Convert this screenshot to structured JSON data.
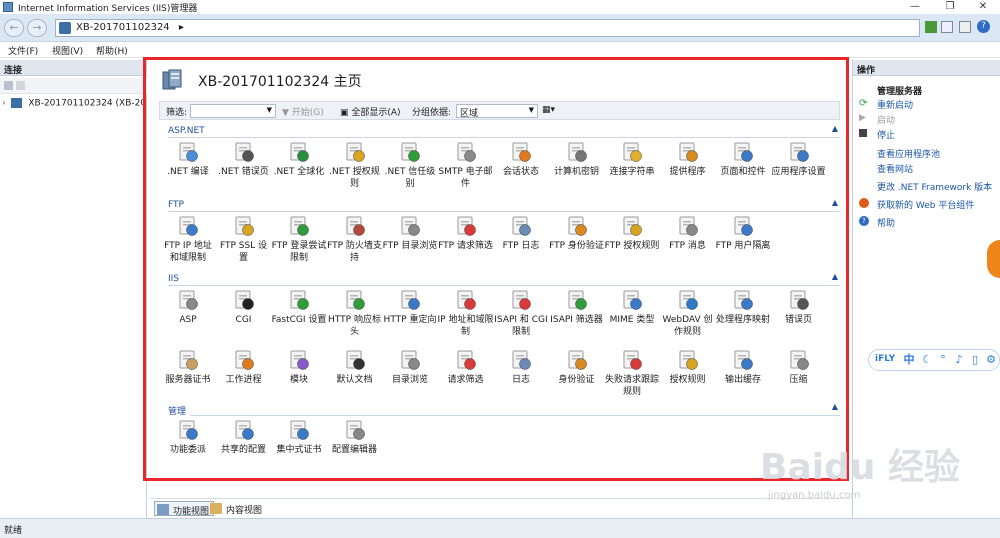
{
  "window": {
    "title": "Internet Information Services (IIS)管理器"
  },
  "address": {
    "path": "XB-201701102324",
    "sep": "▸"
  },
  "menu": {
    "items": [
      "文件(F)",
      "视图(V)",
      "帮助(H)"
    ]
  },
  "left": {
    "header": "连接",
    "tree_item": "XB-201701102324 (XB-2017"
  },
  "center": {
    "title": "XB-201701102324 主页",
    "filter": {
      "label": "筛选:",
      "start": "开始(G)",
      "show_all": "全部显示(A)",
      "group_label": "分组依据:",
      "group_value": "区域"
    },
    "sections": [
      {
        "name": "ASP.NET",
        "items": [
          {
            "label": ".NET 编译",
            "icon": "net-compile-icon",
            "color": "#4a90d9"
          },
          {
            "label": ".NET 错误页",
            "icon": "net-error-pages-icon",
            "color": "#555"
          },
          {
            "label": ".NET 全球化",
            "icon": "net-globalization-icon",
            "color": "#2a8f3a"
          },
          {
            "label": ".NET 授权规则",
            "icon": "net-authorization-icon",
            "color": "#d9a520"
          },
          {
            "label": ".NET 信任级别",
            "icon": "net-trust-levels-icon",
            "color": "#2f9e3a"
          },
          {
            "label": "SMTP 电子邮件",
            "icon": "smtp-email-icon",
            "color": "#8a8a8a"
          },
          {
            "label": "会话状态",
            "icon": "session-state-icon",
            "color": "#e07a20"
          },
          {
            "label": "计算机密钥",
            "icon": "machine-key-icon",
            "color": "#777"
          },
          {
            "label": "连接字符串",
            "icon": "connection-strings-icon",
            "color": "#e0b030"
          },
          {
            "label": "提供程序",
            "icon": "providers-icon",
            "color": "#d98a20"
          },
          {
            "label": "页面和控件",
            "icon": "pages-controls-icon",
            "color": "#3a7ac8"
          },
          {
            "label": "应用程序设置",
            "icon": "app-settings-icon",
            "color": "#3a7ac8"
          }
        ]
      },
      {
        "name": "FTP",
        "items": [
          {
            "label": "FTP IP 地址和域限制",
            "icon": "ftp-ip-restrictions-icon",
            "color": "#3a7ac8"
          },
          {
            "label": "FTP SSL 设置",
            "icon": "ftp-ssl-icon",
            "color": "#d9a520"
          },
          {
            "label": "FTP 登录尝试限制",
            "icon": "ftp-logon-attempts-icon",
            "color": "#2f9e3a"
          },
          {
            "label": "FTP 防火墙支持",
            "icon": "ftp-firewall-icon",
            "color": "#b04a3a"
          },
          {
            "label": "FTP 目录浏览",
            "icon": "ftp-directory-browsing-icon",
            "color": "#888"
          },
          {
            "label": "FTP 请求筛选",
            "icon": "ftp-request-filtering-icon",
            "color": "#d93a3a"
          },
          {
            "label": "FTP 日志",
            "icon": "ftp-logging-icon",
            "color": "#6a8ab8"
          },
          {
            "label": "FTP 身份验证",
            "icon": "ftp-authentication-icon",
            "color": "#d98a20"
          },
          {
            "label": "FTP 授权规则",
            "icon": "ftp-authorization-icon",
            "color": "#d9a520"
          },
          {
            "label": "FTP 消息",
            "icon": "ftp-messages-icon",
            "color": "#888"
          },
          {
            "label": "FTP 用户隔离",
            "icon": "ftp-user-isolation-icon",
            "color": "#3a7ac8"
          }
        ]
      },
      {
        "name": "IIS",
        "items": [
          {
            "label": "ASP",
            "icon": "asp-icon",
            "color": "#888"
          },
          {
            "label": "CGI",
            "icon": "cgi-icon",
            "color": "#222"
          },
          {
            "label": "FastCGI 设置",
            "icon": "fastcgi-icon",
            "color": "#2f9e3a"
          },
          {
            "label": "HTTP 响应标头",
            "icon": "http-response-headers-icon",
            "color": "#2f9e3a"
          },
          {
            "label": "HTTP 重定向",
            "icon": "http-redirect-icon",
            "color": "#3a7ac8"
          },
          {
            "label": "IP 地址和域限制",
            "icon": "ip-restrictions-icon",
            "color": "#d93a3a"
          },
          {
            "label": "ISAPI 和 CGI 限制",
            "icon": "isapi-cgi-restrictions-icon",
            "color": "#d93a3a"
          },
          {
            "label": "ISAPI 筛选器",
            "icon": "isapi-filters-icon",
            "color": "#2f9e3a"
          },
          {
            "label": "MIME 类型",
            "icon": "mime-types-icon",
            "color": "#3a7ac8"
          },
          {
            "label": "WebDAV 创作规则",
            "icon": "webdav-icon",
            "color": "#2f7ac8"
          },
          {
            "label": "处理程序映射",
            "icon": "handler-mappings-icon",
            "color": "#3a7ac8"
          },
          {
            "label": "错误页",
            "icon": "error-pages-icon",
            "color": "#555"
          },
          {
            "label": "服务器证书",
            "icon": "server-certificates-icon",
            "color": "#c8a060"
          },
          {
            "label": "工作进程",
            "icon": "worker-processes-icon",
            "color": "#e07a20"
          },
          {
            "label": "模块",
            "icon": "modules-icon",
            "color": "#8a5ac8"
          },
          {
            "label": "默认文档",
            "icon": "default-document-icon",
            "color": "#333"
          },
          {
            "label": "目录浏览",
            "icon": "directory-browsing-icon",
            "color": "#888"
          },
          {
            "label": "请求筛选",
            "icon": "request-filtering-icon",
            "color": "#d93a3a"
          },
          {
            "label": "日志",
            "icon": "logging-icon",
            "color": "#6a8ab8"
          },
          {
            "label": "身份验证",
            "icon": "authentication-icon",
            "color": "#d98a20"
          },
          {
            "label": "失败请求跟踪规则",
            "icon": "failed-request-tracing-icon",
            "color": "#d93a3a"
          },
          {
            "label": "授权规则",
            "icon": "authorization-rules-icon",
            "color": "#d9a520"
          },
          {
            "label": "输出缓存",
            "icon": "output-caching-icon",
            "color": "#3a7ac8"
          },
          {
            "label": "压缩",
            "icon": "compression-icon",
            "color": "#888"
          }
        ]
      },
      {
        "name": "管理",
        "items": [
          {
            "label": "功能委派",
            "icon": "feature-delegation-icon",
            "color": "#3a7ac8"
          },
          {
            "label": "共享的配置",
            "icon": "shared-configuration-icon",
            "color": "#3a7ac8"
          },
          {
            "label": "集中式证书",
            "icon": "centralized-certificates-icon",
            "color": "#3a7ac8"
          },
          {
            "label": "配置编辑器",
            "icon": "configuration-editor-icon",
            "color": "#888"
          }
        ]
      }
    ],
    "tabs": {
      "features": "功能视图",
      "content": "内容视图"
    }
  },
  "right": {
    "header": "操作",
    "manage_title": "管理服务器",
    "restart": "重新启动",
    "start": "启动",
    "stop": "停止",
    "view_app_pools": "查看应用程序池",
    "view_sites": "查看网站",
    "change_framework": "更改 .NET Framework 版本",
    "get_web_components": "获取新的 Web 平台组件",
    "help": "帮助"
  },
  "status": {
    "text": "就绪"
  },
  "ime": {
    "logo": "iFLY",
    "mode": "中"
  },
  "watermark": {
    "text": "Baidu 经验",
    "url": "jingyan.baidu.com"
  },
  "colors": {
    "accent": "#1b57a8",
    "highlight": "#e8262c"
  }
}
